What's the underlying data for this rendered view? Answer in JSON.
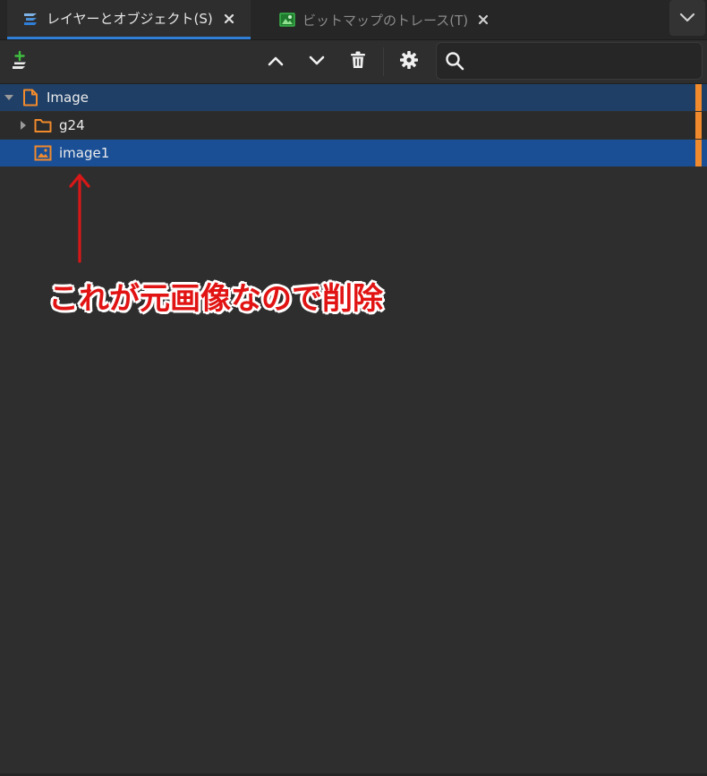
{
  "tabs": [
    {
      "label": "レイヤーとオブジェクト(S)",
      "icon": "layers-icon",
      "active": true
    },
    {
      "label": "ビットマップのトレース(T)",
      "icon": "bitmap-trace-icon",
      "active": false
    }
  ],
  "toolbar": {
    "add_layer": "add-layer-icon",
    "raise": "chevron-up-icon",
    "lower": "chevron-down-icon",
    "delete": "trash-icon",
    "settings": "gear-icon",
    "search_value": "",
    "search_placeholder": ""
  },
  "tree": {
    "root": {
      "label": "Image",
      "icon": "document-icon",
      "expanded": true
    },
    "children": [
      {
        "label": "g24",
        "icon": "folder-icon",
        "expanded": false
      },
      {
        "label": "image1",
        "icon": "image-icon",
        "selected": true
      }
    ]
  },
  "annotation": {
    "text": "これが元画像なので削除",
    "color": "#e11313"
  },
  "colors": {
    "accent_blue": "#2f7ed8",
    "selected_row": "#1a4f96",
    "root_row": "#1f3f66",
    "marker_orange": "#f08a2c",
    "icon_orange": "#f08a2c",
    "add_green": "#3fbf3f"
  }
}
